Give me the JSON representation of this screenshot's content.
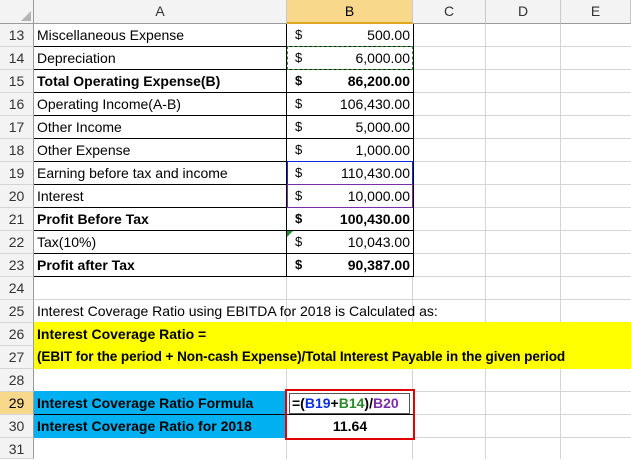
{
  "columns": [
    "A",
    "B",
    "C",
    "D",
    "E"
  ],
  "rows": [
    {
      "num": "13",
      "label": "Miscellaneous Expense",
      "cur": "$",
      "value": "500.00",
      "bold": false
    },
    {
      "num": "14",
      "label": "Depreciation",
      "cur": "$",
      "value": "6,000.00",
      "bold": false
    },
    {
      "num": "15",
      "label": "Total Operating Expense(B)",
      "cur": "$",
      "value": "86,200.00",
      "bold": true
    },
    {
      "num": "16",
      "label": "Operating Income(A-B)",
      "cur": "$",
      "value": "106,430.00",
      "bold": false
    },
    {
      "num": "17",
      "label": "Other Income",
      "cur": "$",
      "value": "5,000.00",
      "bold": false
    },
    {
      "num": "18",
      "label": "Other Expense",
      "cur": "$",
      "value": "1,000.00",
      "bold": false
    },
    {
      "num": "19",
      "label": "Earning before tax and income",
      "cur": "$",
      "value": "110,430.00",
      "bold": false
    },
    {
      "num": "20",
      "label": "Interest",
      "cur": "$",
      "value": "10,000.00",
      "bold": false
    },
    {
      "num": "21",
      "label": "Profit Before Tax",
      "cur": "$",
      "value": "100,430.00",
      "bold": true
    },
    {
      "num": "22",
      "label": "Tax(10%)",
      "cur": "$",
      "value": "10,043.00",
      "bold": false
    },
    {
      "num": "23",
      "label": "Profit after Tax",
      "cur": "$",
      "value": "90,387.00",
      "bold": true
    }
  ],
  "extra_rows": [
    "24",
    "25",
    "26",
    "27",
    "28",
    "29",
    "30",
    "31"
  ],
  "note": {
    "line25": "Interest Coverage Ratio using EBITDA for 2018 is Calculated as:",
    "line26": "Interest Coverage Ratio =",
    "line27": "(EBIT for the period + Non-cash Expense)/Total Interest Payable in the given period"
  },
  "formula": {
    "label": "Interest Coverage Ratio Formula",
    "part_open": "=(",
    "ref1": "B19",
    "plus": "+",
    "ref2": "B14",
    "part_close": ")/",
    "ref3": "B20"
  },
  "result": {
    "label": "Interest Coverage Ratio  for 2018",
    "value": "11.64"
  },
  "colors": {
    "highlight_yellow": "#ffff00",
    "label_blue": "#00b0f0",
    "result_border": "#e00000"
  }
}
